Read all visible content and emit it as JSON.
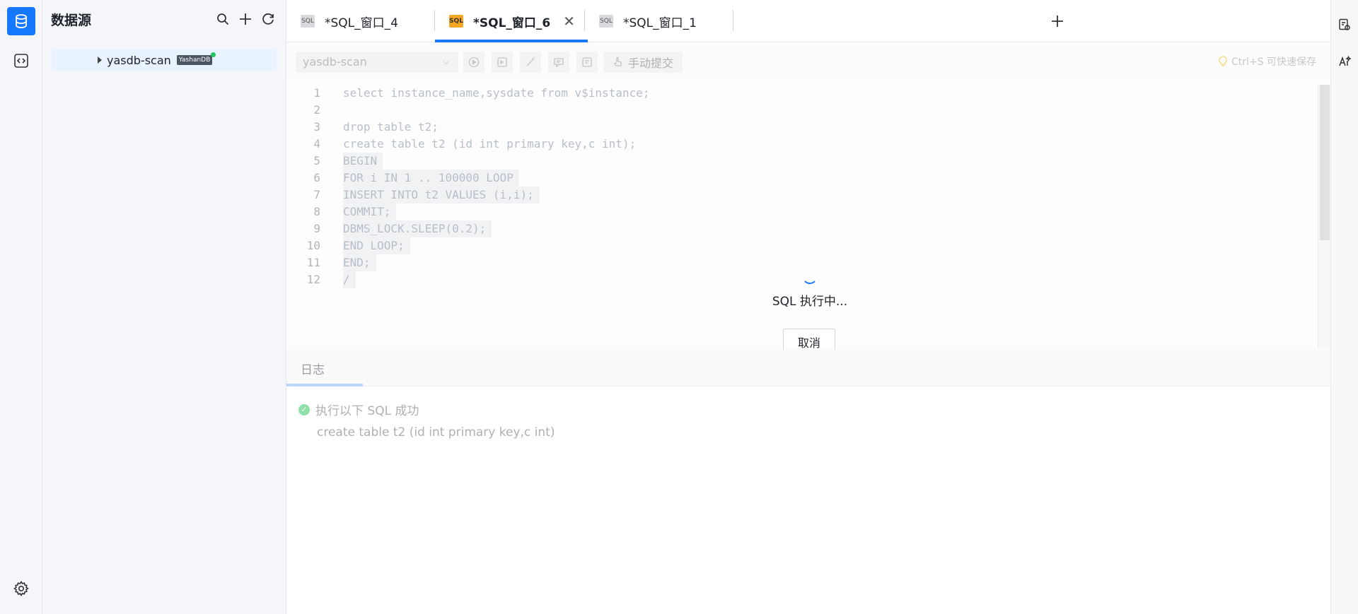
{
  "sidebar": {
    "title": "数据源",
    "tree": [
      {
        "label": "yasdb-scan",
        "badge": "YashanDB",
        "status": "online"
      }
    ]
  },
  "tabs": [
    {
      "label": "*SQL_窗口_4",
      "icon": "SQL",
      "active": false
    },
    {
      "label": "*SQL_窗口_6",
      "icon": "SQL",
      "active": true
    },
    {
      "label": "*SQL_窗口_1",
      "icon": "SQL",
      "active": false
    }
  ],
  "toolbar": {
    "connection": "yasdb-scan",
    "commit_label": "手动提交",
    "save_hint": "Ctrl+S 可快速保存"
  },
  "editor": {
    "lines": [
      {
        "n": "1",
        "text": "select instance_name,sysdate from v$instance;"
      },
      {
        "n": "2",
        "text": ""
      },
      {
        "n": "3",
        "text": "drop table t2;"
      },
      {
        "n": "4",
        "text": "create table t2 (id int primary key,c int);"
      },
      {
        "n": "5",
        "text": "BEGIN"
      },
      {
        "n": "6",
        "text": "FOR i IN 1 .. 100000 LOOP"
      },
      {
        "n": "7",
        "text": "INSERT INTO t2 VALUES (i,i);"
      },
      {
        "n": "8",
        "text": "COMMIT;"
      },
      {
        "n": "9",
        "text": "DBMS_LOCK.SLEEP(0.2);"
      },
      {
        "n": "10",
        "text": "END LOOP;"
      },
      {
        "n": "11",
        "text": "END;"
      },
      {
        "n": "12",
        "text": "/"
      }
    ]
  },
  "loading": {
    "text": "SQL 执行中...",
    "cancel_label": "取消"
  },
  "log": {
    "tab_label": "日志",
    "entries": [
      {
        "status": "执行以下 SQL 成功",
        "sql": "create table t2 (id int primary key,c int)"
      }
    ]
  },
  "colors": {
    "accent": "#1677ff",
    "active_tab_icon": "#f5a623",
    "online": "#22c55e"
  }
}
